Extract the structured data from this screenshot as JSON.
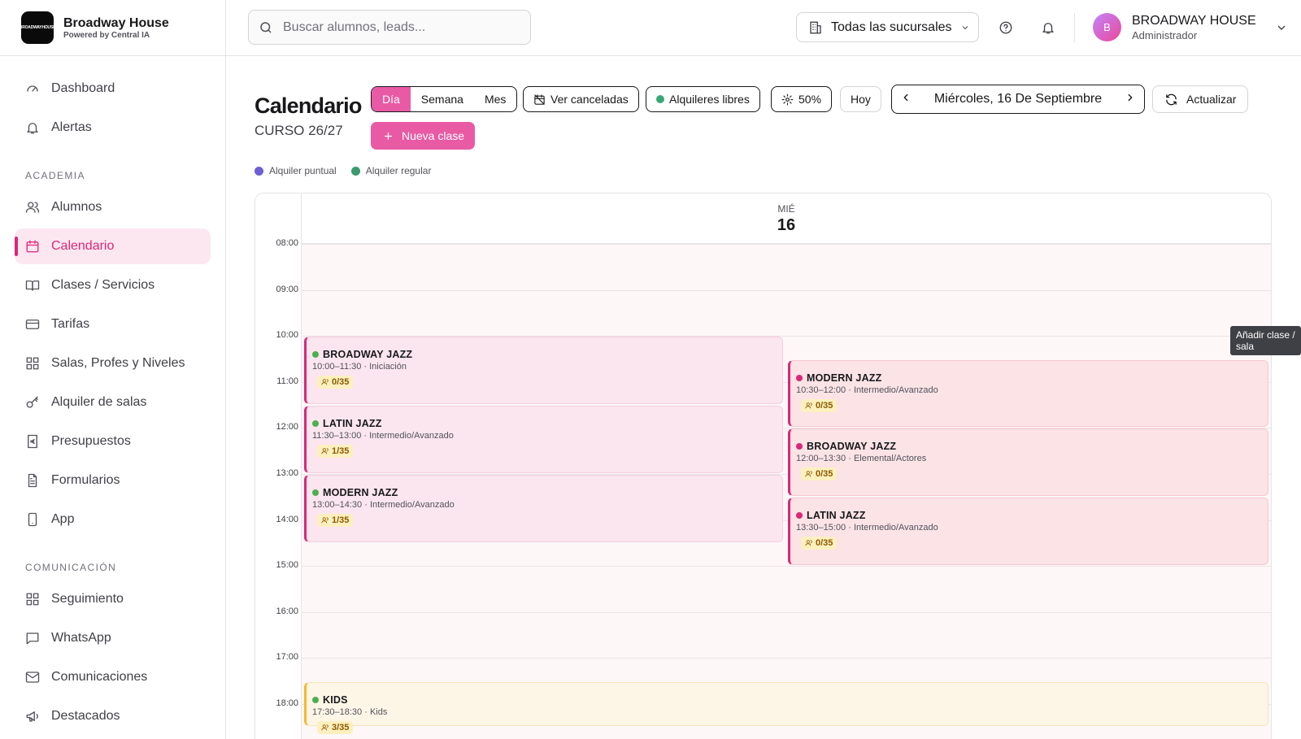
{
  "brand": {
    "name": "Broadway House",
    "subtitle": "Powered by Central IA",
    "logo_text": "BROADWAYHOUSE"
  },
  "sidebar": {
    "top_items": [
      {
        "label": "Dashboard",
        "icon": "gauge-icon"
      },
      {
        "label": "Alertas",
        "icon": "bell-icon"
      }
    ],
    "section_academia": "ACADEMIA",
    "academia_items": [
      {
        "label": "Alumnos",
        "icon": "users-icon"
      },
      {
        "label": "Calendario",
        "icon": "calendar-icon",
        "active": true
      },
      {
        "label": "Clases / Servicios",
        "icon": "book-icon"
      },
      {
        "label": "Tarifas",
        "icon": "credit-card-icon"
      },
      {
        "label": "Salas, Profes y Niveles",
        "icon": "grid-icon"
      },
      {
        "label": "Alquiler de salas",
        "icon": "key-icon"
      },
      {
        "label": "Presupuestos",
        "icon": "euro-receipt-icon"
      },
      {
        "label": "Formularios",
        "icon": "file-text-icon"
      },
      {
        "label": "App",
        "icon": "smartphone-icon"
      }
    ],
    "section_comunicacion": "COMUNICACIÓN",
    "comunicacion_items": [
      {
        "label": "Seguimiento",
        "icon": "grid-icon"
      },
      {
        "label": "WhatsApp",
        "icon": "message-icon"
      },
      {
        "label": "Comunicaciones",
        "icon": "mail-icon"
      },
      {
        "label": "Destacados",
        "icon": "megaphone-icon"
      }
    ]
  },
  "topbar": {
    "search_placeholder": "Buscar alumnos, leads...",
    "branch_selector": "Todas las sucursales",
    "user_initial": "B",
    "user_name": "BROADWAY HOUSE",
    "user_role": "Administrador"
  },
  "calendar": {
    "title": "Calendario",
    "course": "CURSO 26/27",
    "views": {
      "day": "Día",
      "week": "Semana",
      "month": "Mes",
      "active": "day"
    },
    "show_cancelled": "Ver canceladas",
    "free_rentals": "Alquileres libres",
    "zoom": "50%",
    "today": "Hoy",
    "current_date": "Miércoles, 16 De Septiembre",
    "refresh": "Actualizar",
    "new_class": "Nueva clase",
    "legend": [
      {
        "label": "Alquiler puntual",
        "color": "#6d5fd3"
      },
      {
        "label": "Alquiler regular",
        "color": "#3a9a6e"
      }
    ],
    "day_name": "MIÉ",
    "day_number": "16",
    "hours": [
      "08:00",
      "09:00",
      "10:00",
      "11:00",
      "12:00",
      "13:00",
      "14:00",
      "15:00",
      "16:00",
      "17:00",
      "18:00"
    ],
    "tooltip": "Añadir clase / sala",
    "events": [
      {
        "title": "BROADWAY JAZZ",
        "time": "10:00–11:30",
        "level": "Iniciación",
        "capacity": "0/35",
        "start": 10.0,
        "end": 11.5,
        "column": 0,
        "style": "pink",
        "dot": "#4caf50"
      },
      {
        "title": "LATIN JAZZ",
        "time": "11:30–13:00",
        "level": "Intermedio/Avanzado",
        "capacity": "1/35",
        "start": 11.5,
        "end": 13.0,
        "column": 0,
        "style": "pink",
        "dot": "#4caf50"
      },
      {
        "title": "MODERN JAZZ",
        "time": "13:00–14:30",
        "level": "Intermedio/Avanzado",
        "capacity": "1/35",
        "start": 13.0,
        "end": 14.5,
        "column": 0,
        "style": "pink",
        "dot": "#4caf50"
      },
      {
        "title": "MODERN JAZZ",
        "time": "10:30–12:00",
        "level": "Intermedio/Avanzado",
        "capacity": "0/35",
        "start": 10.5,
        "end": 12.0,
        "column": 1,
        "style": "rose",
        "dot": "#db2777"
      },
      {
        "title": "BROADWAY JAZZ",
        "time": "12:00–13:30",
        "level": "Elemental/Actores",
        "capacity": "0/35",
        "start": 12.0,
        "end": 13.5,
        "column": 1,
        "style": "rose",
        "dot": "#db2777"
      },
      {
        "title": "LATIN JAZZ",
        "time": "13:30–15:00",
        "level": "Intermedio/Avanzado",
        "capacity": "0/35",
        "start": 13.5,
        "end": 15.0,
        "column": 1,
        "style": "rose",
        "dot": "#db2777"
      },
      {
        "title": "KIDS",
        "time": "17:30–18:30",
        "level": "Kids",
        "capacity": "3/35",
        "start": 17.5,
        "end": 18.5,
        "column": "full",
        "style": "kids",
        "dot": "#4caf50"
      }
    ]
  }
}
